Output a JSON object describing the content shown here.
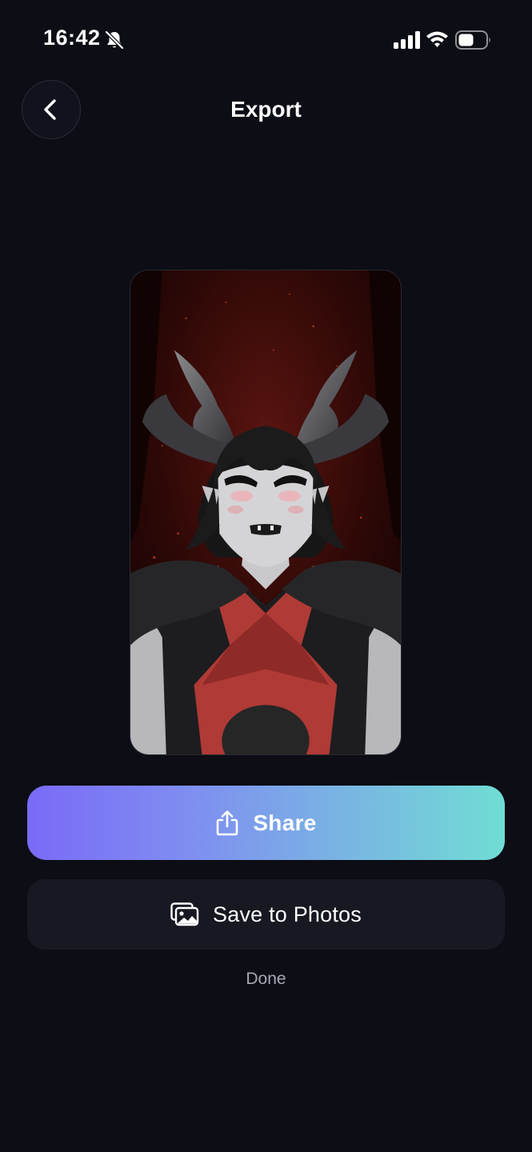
{
  "status_bar": {
    "time": "16:42",
    "icons": [
      "bell-slash-icon",
      "cellular-signal-icon",
      "wifi-icon",
      "battery-icon"
    ]
  },
  "header": {
    "title": "Export",
    "back_icon": "chevron-left-icon"
  },
  "preview": {
    "image": "character-render-preview"
  },
  "actions": {
    "share_label": "Share",
    "share_icon": "share-icon",
    "save_label": "Save to Photos",
    "save_icon": "photos-icon",
    "done_label": "Done"
  },
  "colors": {
    "background": "#0c0d15",
    "share_gradient_start": "#7a6af7",
    "share_gradient_end": "#70ddd4",
    "secondary_button": "#171821",
    "muted_text": "#a6a8b3"
  }
}
